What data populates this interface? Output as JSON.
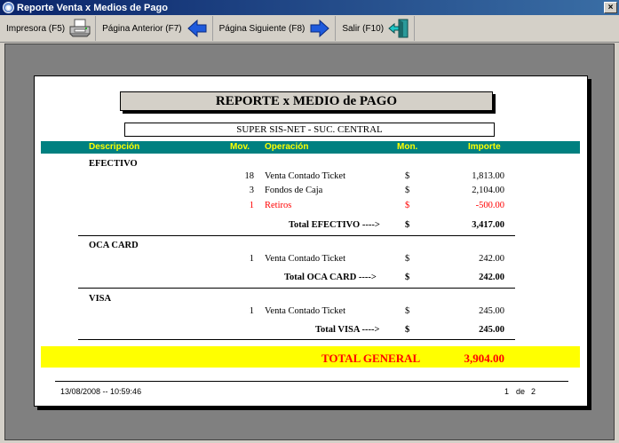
{
  "window": {
    "title": "Reporte Venta x Medios de Pago",
    "close_label": "×"
  },
  "toolbar": {
    "print_label": "Impresora (F5)",
    "prev_label": "Página Anterior (F7)",
    "next_label": "Página Siguiente (F8)",
    "exit_label": "Salir (F10)"
  },
  "report": {
    "title": "REPORTE x MEDIO de PAGO",
    "company": "SUPER SIS-NET - SUC. CENTRAL",
    "headers": {
      "desc": "Descripción",
      "mov": "Mov.",
      "op": "Operación",
      "mon": "Mon.",
      "imp": "Importe"
    },
    "groups": [
      {
        "name": "EFECTIVO",
        "rows": [
          {
            "mov": "18",
            "op": "Venta Contado Ticket",
            "mon": "$",
            "imp": "1,813.00"
          },
          {
            "mov": "3",
            "op": "Fondos de Caja",
            "mon": "$",
            "imp": "2,104.00"
          },
          {
            "mov": "1",
            "op": "Retiros",
            "mon": "$",
            "imp": "-500.00"
          }
        ],
        "total_label": "Total EFECTIVO ---->",
        "total_mon": "$",
        "total": "3,417.00"
      },
      {
        "name": "OCA CARD",
        "rows": [
          {
            "mov": "1",
            "op": "Venta Contado Ticket",
            "mon": "$",
            "imp": "242.00"
          }
        ],
        "total_label": "Total OCA CARD ---->",
        "total_mon": "$",
        "total": "242.00"
      },
      {
        "name": "VISA",
        "rows": [
          {
            "mov": "1",
            "op": "Venta Contado Ticket",
            "mon": "$",
            "imp": "245.00"
          }
        ],
        "total_label": "Total VISA ---->",
        "total_mon": "$",
        "total": "245.00"
      }
    ],
    "grand_total_label": "TOTAL GENERAL",
    "grand_total": "3,904.00",
    "footer": {
      "datetime": "13/08/2008 -- 10:59:46",
      "page": "1",
      "of": "de",
      "pages": "2"
    }
  },
  "colors": {
    "header_bg": "#008080",
    "header_text": "#ffff00",
    "total_bg": "#ffff00",
    "negative": "#ff0000"
  }
}
